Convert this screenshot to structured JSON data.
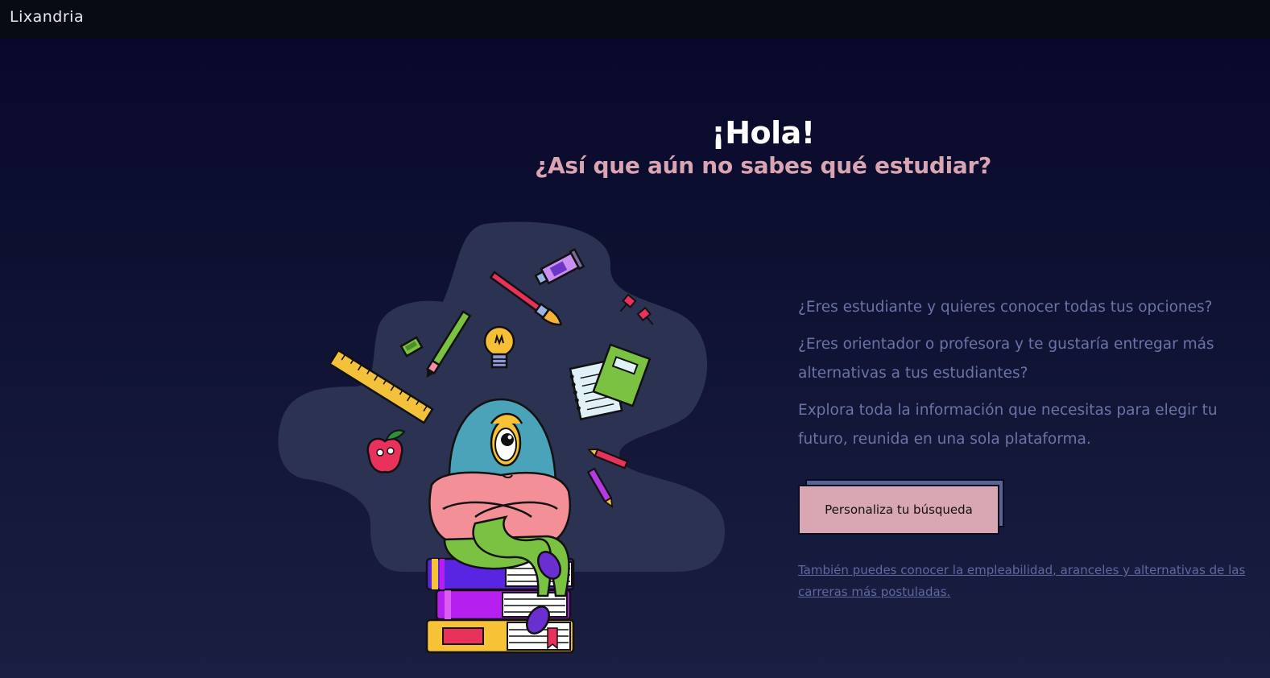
{
  "app": {
    "brand": "Lixandria"
  },
  "hero": {
    "title": "¡Hola!",
    "subtitle": "¿Así que aún no sabes qué estudiar?"
  },
  "copy": {
    "paragraphs": [
      "¿Eres estudiante y quieres conocer todas tus opciones?",
      "¿Eres orientador o profesora y te gustaría entregar más alternativas a tus estudiantes?",
      "Explora toda la información que necesitas para elegir tu futuro, reunida en una sola plataforma."
    ]
  },
  "cta": {
    "label": "Personaliza tu búsqueda"
  },
  "secondary_link": {
    "label": "También puedes conocer la empleabilidad, aranceles y alternativas de las carreras más postuladas."
  },
  "illustration": {
    "subject": "one-eyed-monster-on-books-icon",
    "items": [
      "ruler-icon",
      "marker-icon",
      "pen-icon",
      "paintbrush-icon",
      "paint-tube-icon",
      "lightbulb-icon",
      "pushpin-icon",
      "notebook-icon",
      "apple-icon",
      "pencil-icon",
      "books-stack-icon"
    ]
  },
  "colors": {
    "accent_pink": "#d9a7b1",
    "text_muted": "#6b73a8",
    "blob": "#2c3352",
    "topbar": "#070c14"
  }
}
